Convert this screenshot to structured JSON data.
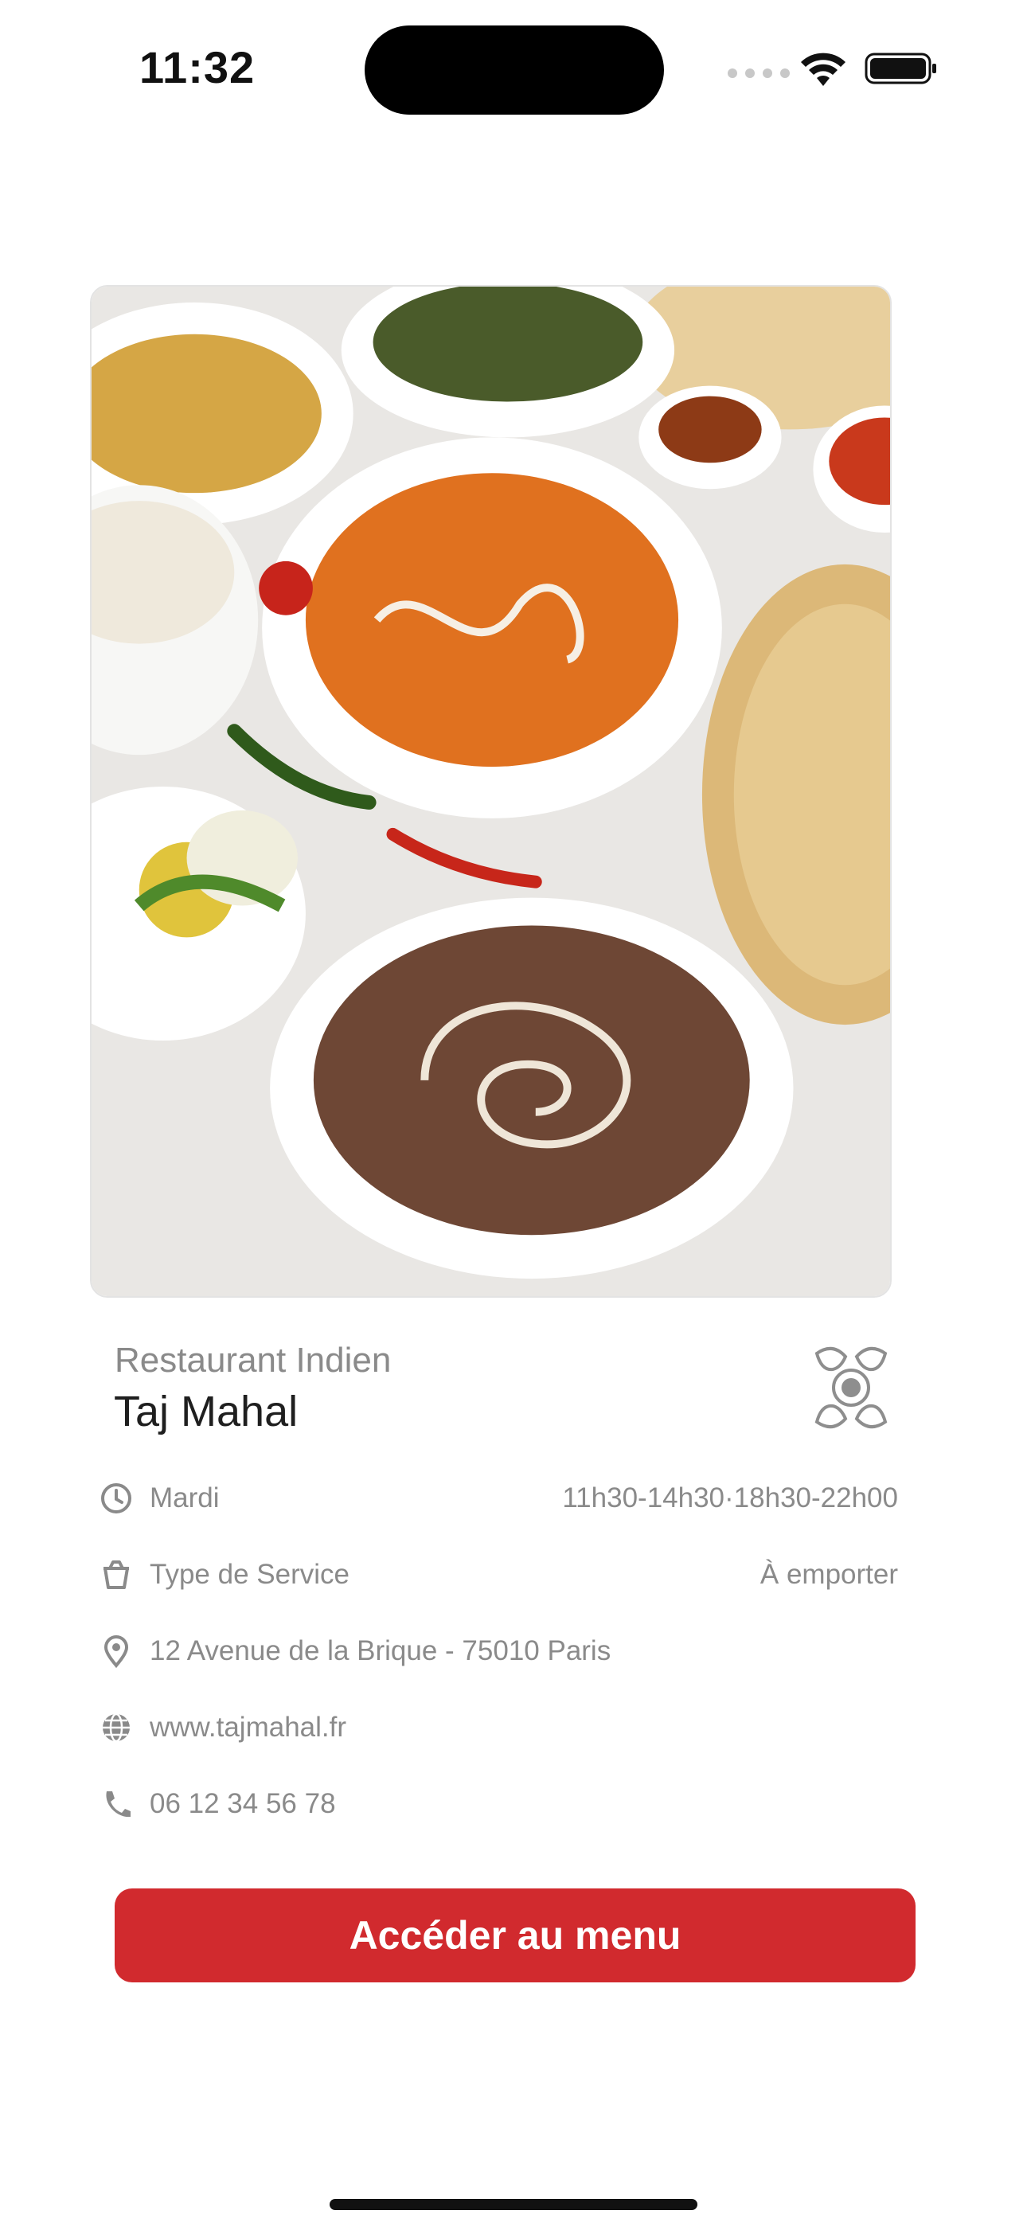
{
  "status_bar": {
    "time": "11:32",
    "icons": [
      "cellular-signal-icon",
      "wifi-icon",
      "battery-icon"
    ]
  },
  "hero_image": {
    "alt": "Plats indiens"
  },
  "restaurant": {
    "category": "Restaurant Indien",
    "name": "Taj Mahal",
    "logo_icon": "restaurant-logo-icon"
  },
  "info": {
    "hours": {
      "icon": "clock-icon",
      "label": "Mardi",
      "value": "11h30-14h30·18h30-22h00"
    },
    "service": {
      "icon": "takeaway-box-icon",
      "label": "Type de Service",
      "value": "À emporter"
    },
    "address": {
      "icon": "location-pin-icon",
      "label": "12 Avenue de la Brique - 75010 Paris"
    },
    "website": {
      "icon": "globe-icon",
      "label": "www.tajmahal.fr"
    },
    "phone": {
      "icon": "phone-icon",
      "label": "06 12 34 56 78"
    }
  },
  "cta": {
    "label": "Accéder au menu",
    "color": "#d12a2e"
  }
}
